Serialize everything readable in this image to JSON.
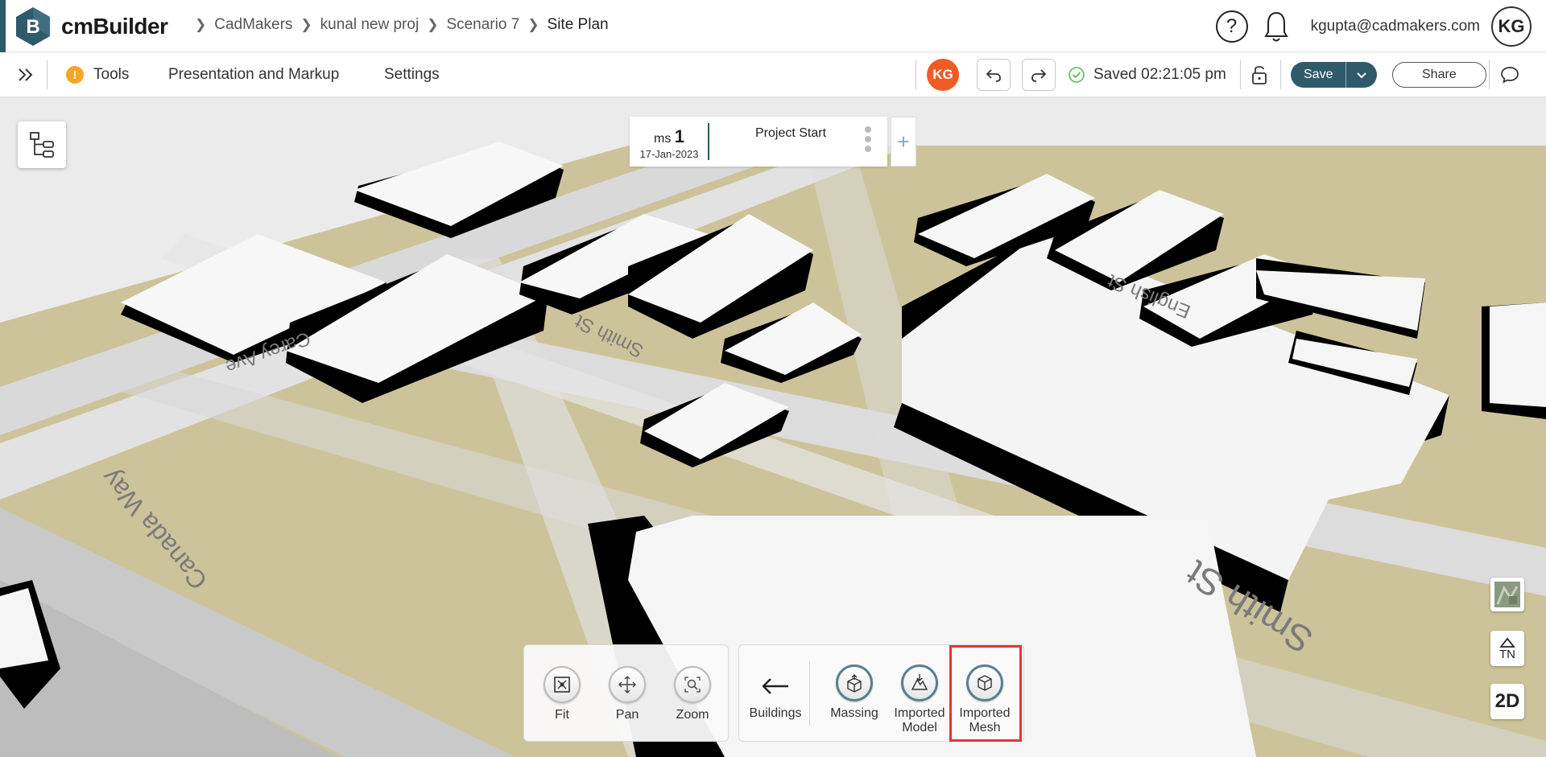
{
  "app": {
    "name": "cmBuilder"
  },
  "breadcrumbs": [
    "CadMakers",
    "kunal new proj",
    "Scenario 7",
    "Site Plan"
  ],
  "header": {
    "help_symbol": "?",
    "user_email": "kgupta@cadmakers.com",
    "user_initials": "KG"
  },
  "toolbar": {
    "tools_label": "Tools",
    "warn_symbol": "!",
    "presentation_label": "Presentation and Markup",
    "settings_label": "Settings",
    "avatar_initials": "KG",
    "saved_status": "Saved 02:21:05 pm",
    "save_label": "Save",
    "share_label": "Share"
  },
  "milestone": {
    "prefix": "ms",
    "number": "1",
    "date": "17-Jan-2023",
    "title": "Project Start",
    "add_symbol": "+"
  },
  "view_tools": [
    {
      "label": "Fit"
    },
    {
      "label": "Pan"
    },
    {
      "label": "Zoom"
    }
  ],
  "layer_tools": {
    "back_label": "Buildings",
    "items": [
      {
        "line1": "Massing",
        "line2": ""
      },
      {
        "line1": "Imported",
        "line2": "Model"
      },
      {
        "line1": "Imported",
        "line2": "Mesh"
      }
    ]
  },
  "map": {
    "streets": [
      "Carey Ave",
      "Smith St",
      "English St",
      "Canada Way",
      "Smith St"
    ]
  },
  "right_controls": {
    "north_label": "TN",
    "view_mode_label": "2D"
  },
  "colors": {
    "brand": "#2f5a6b",
    "avatar": "#f15a24",
    "highlight": "#e2343a",
    "warning": "#f5a623",
    "ground": "#cdc39a"
  }
}
